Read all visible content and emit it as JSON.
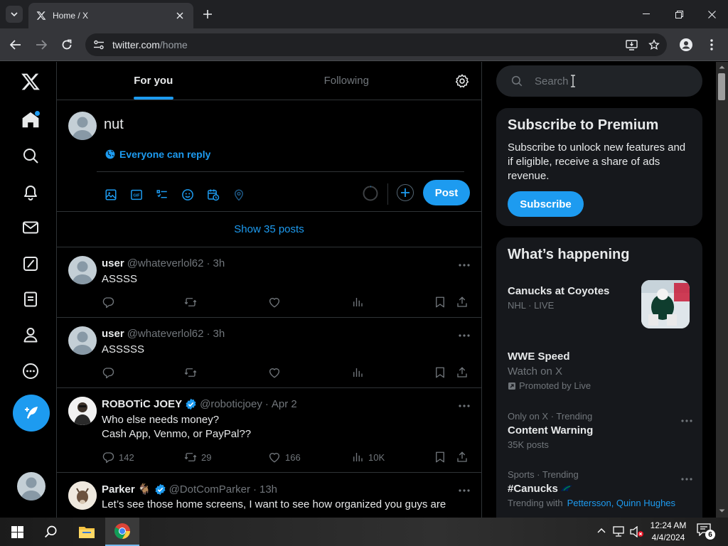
{
  "browser": {
    "tab_title": "Home / X",
    "url_domain": "twitter.com",
    "url_path": "/home"
  },
  "tabs": {
    "for_you": "For you",
    "following": "Following"
  },
  "composer": {
    "text": "nut",
    "reply_setting": "Everyone can reply",
    "post_label": "Post"
  },
  "show_posts": "Show 35 posts",
  "posts": [
    {
      "name": "user",
      "handle": "@whateverlol62",
      "time": "3h",
      "text": "ASSSS",
      "text2": "",
      "replies": "",
      "reposts": "",
      "likes": "",
      "views": ""
    },
    {
      "name": "user",
      "handle": "@whateverlol62",
      "time": "3h",
      "text": "ASSSSS",
      "text2": "",
      "replies": "",
      "reposts": "",
      "likes": "",
      "views": ""
    },
    {
      "name": "ROBOTiC JOEY",
      "handle": "@roboticjoey",
      "time": "Apr 2",
      "text": "Who else needs money?",
      "text2": "Cash App, Venmo, or PayPal??",
      "replies": "142",
      "reposts": "29",
      "likes": "166",
      "views": "10K"
    },
    {
      "name": "Parker 🐐",
      "handle": "@DotComParker",
      "time": "13h",
      "text": "Let’s see those home screens, I want to see how organized you guys are",
      "text2": "",
      "replies": "",
      "reposts": "",
      "likes": "",
      "views": ""
    }
  ],
  "search": {
    "placeholder": "Search"
  },
  "premium": {
    "title": "Subscribe to Premium",
    "desc": "Subscribe to unlock new features and if eligible, receive a share of ads revenue.",
    "button": "Subscribe"
  },
  "happening": {
    "title": "What’s happening",
    "trends": [
      {
        "meta": "",
        "title": "Canucks at Coyotes",
        "sub": "NHL · LIVE"
      },
      {
        "meta": "",
        "title": "WWE Speed",
        "sub": "Watch on X",
        "promo": "Promoted by Live"
      },
      {
        "meta": "Only on X · Trending",
        "title": "Content Warning",
        "sub": "35K posts"
      },
      {
        "meta": "Sports · Trending",
        "title": "#Canucks",
        "sub": "Trending with",
        "links": "Pettersson, Quinn Hughes"
      }
    ]
  },
  "taskbar": {
    "time": "12:24 AM",
    "date": "4/4/2024",
    "notifications": "6"
  },
  "colors": {
    "accent": "#1d9bf0",
    "background": "#000000",
    "card": "#16181c",
    "border": "#2f3336"
  }
}
